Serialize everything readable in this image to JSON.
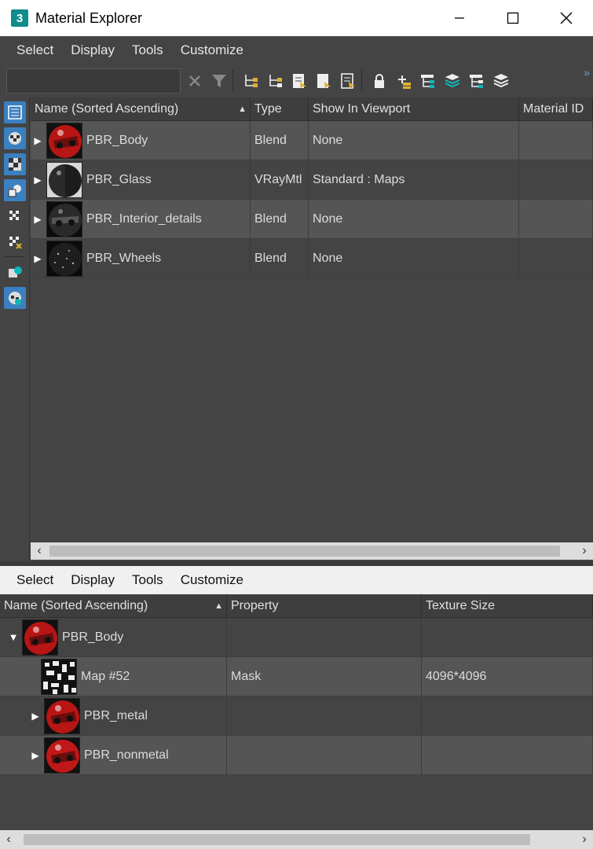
{
  "window": {
    "title": "Material Explorer",
    "app_icon_text": "3"
  },
  "top_menu": [
    "Select",
    "Display",
    "Tools",
    "Customize"
  ],
  "bottom_menu": [
    "Select",
    "Display",
    "Tools",
    "Customize"
  ],
  "search": {
    "value": "",
    "placeholder": ""
  },
  "top_grid": {
    "columns": [
      "Name (Sorted Ascending)",
      "Type",
      "Show In Viewport",
      "Material ID"
    ],
    "rows": [
      {
        "name": "PBR_Body",
        "type": "Blend",
        "show": "None",
        "id": ""
      },
      {
        "name": "PBR_Glass",
        "type": "VRayMtl",
        "show": "Standard : Maps",
        "id": ""
      },
      {
        "name": "PBR_Interior_details",
        "type": "Blend",
        "show": "None",
        "id": ""
      },
      {
        "name": "PBR_Wheels",
        "type": "Blend",
        "show": "None",
        "id": ""
      }
    ]
  },
  "bottom_grid": {
    "columns": [
      "Name (Sorted Ascending)",
      "Property",
      "Texture Size"
    ],
    "rows": [
      {
        "name": "PBR_Body",
        "property": "",
        "size": ""
      },
      {
        "name": "Map #52",
        "property": "Mask",
        "size": "4096*4096"
      },
      {
        "name": "PBR_metal",
        "property": "",
        "size": ""
      },
      {
        "name": "PBR_nonmetal",
        "property": "",
        "size": ""
      }
    ]
  },
  "colors": {
    "accent": "#3b80c0",
    "panel": "#444444",
    "icon_teal": "#0f8c8c",
    "icon_yellow": "#e0b030"
  }
}
